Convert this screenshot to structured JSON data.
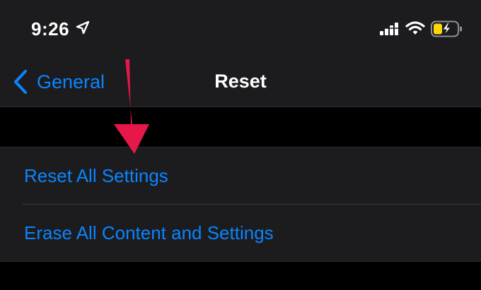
{
  "status_bar": {
    "time": "9:26",
    "icons": [
      "location-arrow-icon",
      "cellular-signal-icon",
      "wifi-icon",
      "battery-charging-icon"
    ]
  },
  "nav_bar": {
    "back_label": "General",
    "title": "Reset"
  },
  "reset_options": [
    {
      "label": "Reset All Settings"
    },
    {
      "label": "Erase All Content and Settings"
    }
  ],
  "colors": {
    "accent": "#0a84ff",
    "background": "#000000",
    "surface": "#1c1c1e",
    "separator": "#3a3a3c",
    "annotation_arrow": "#e8174a",
    "battery_fill": "#ffd60a"
  }
}
